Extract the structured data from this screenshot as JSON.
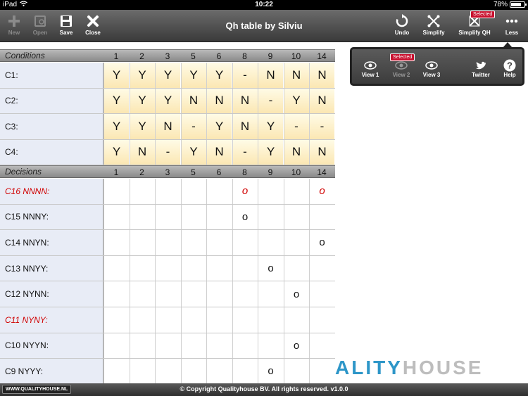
{
  "status_bar": {
    "device": "iPad",
    "time": "10:22",
    "battery": "78%",
    "battery_level": 0.78
  },
  "toolbar": {
    "title": "Qh table by Silviu",
    "new_label": "New",
    "open_label": "Open",
    "save_label": "Save",
    "close_label": "Close",
    "undo_label": "Undo",
    "simplify_label": "Simplify",
    "simplify_qh_label": "Simplify QH",
    "simplify_qh_badge": "Selected",
    "less_label": "Less"
  },
  "popover": {
    "view1_label": "View 1",
    "view2_label": "View 2",
    "view2_badge": "Selected",
    "view3_label": "View 3",
    "twitter_label": "Twitter",
    "help_label": "Help"
  },
  "table": {
    "columns": [
      "1",
      "2",
      "3",
      "5",
      "6",
      "8",
      "9",
      "10",
      "14"
    ],
    "conditions_header": "Conditions",
    "conditions": [
      {
        "label": "C1:",
        "values": [
          "Y",
          "Y",
          "Y",
          "Y",
          "Y",
          "-",
          "N",
          "N",
          "N"
        ]
      },
      {
        "label": "C2:",
        "values": [
          "Y",
          "Y",
          "Y",
          "N",
          "N",
          "N",
          "-",
          "Y",
          "N"
        ]
      },
      {
        "label": "C3:",
        "values": [
          "Y",
          "Y",
          "N",
          "-",
          "Y",
          "N",
          "Y",
          "-",
          "-"
        ]
      },
      {
        "label": "C4:",
        "values": [
          "Y",
          "N",
          "-",
          "Y",
          "N",
          "-",
          "Y",
          "N",
          "N"
        ]
      }
    ],
    "decisions_header": "Decisions",
    "decisions": [
      {
        "label": "C16 NNNN:",
        "red": true,
        "values": [
          "",
          "",
          "",
          "",
          "",
          "o",
          "",
          "",
          "o"
        ]
      },
      {
        "label": "C15 NNNY:",
        "red": false,
        "values": [
          "",
          "",
          "",
          "",
          "",
          "o",
          "",
          "",
          ""
        ]
      },
      {
        "label": "C14 NNYN:",
        "red": false,
        "values": [
          "",
          "",
          "",
          "",
          "",
          "",
          "",
          "",
          "o"
        ]
      },
      {
        "label": "C13 NNYY:",
        "red": false,
        "values": [
          "",
          "",
          "",
          "",
          "",
          "",
          "o",
          "",
          ""
        ]
      },
      {
        "label": "C12 NYNN:",
        "red": false,
        "values": [
          "",
          "",
          "",
          "",
          "",
          "",
          "",
          "o",
          ""
        ]
      },
      {
        "label": "C11 NYNY:",
        "red": true,
        "values": [
          "",
          "",
          "",
          "",
          "",
          "",
          "",
          "",
          ""
        ]
      },
      {
        "label": "C10 NYYN:",
        "red": false,
        "values": [
          "",
          "",
          "",
          "",
          "",
          "",
          "",
          "o",
          ""
        ]
      },
      {
        "label": "C9 NYYY:",
        "red": false,
        "values": [
          "",
          "",
          "",
          "",
          "",
          "",
          "o",
          "",
          ""
        ]
      }
    ]
  },
  "logo": {
    "part1": "ALITY",
    "part2": "HOUSE"
  },
  "footer": {
    "link": "WWW.QUALITYHOUSE.NL",
    "copyright": "© Copyright Qualityhouse BV. All rights reserved. v1.0.0"
  },
  "colors": {
    "accent_blue": "#2d96c8",
    "badge_red": "#c8102e",
    "decision_red": "#d00000"
  }
}
